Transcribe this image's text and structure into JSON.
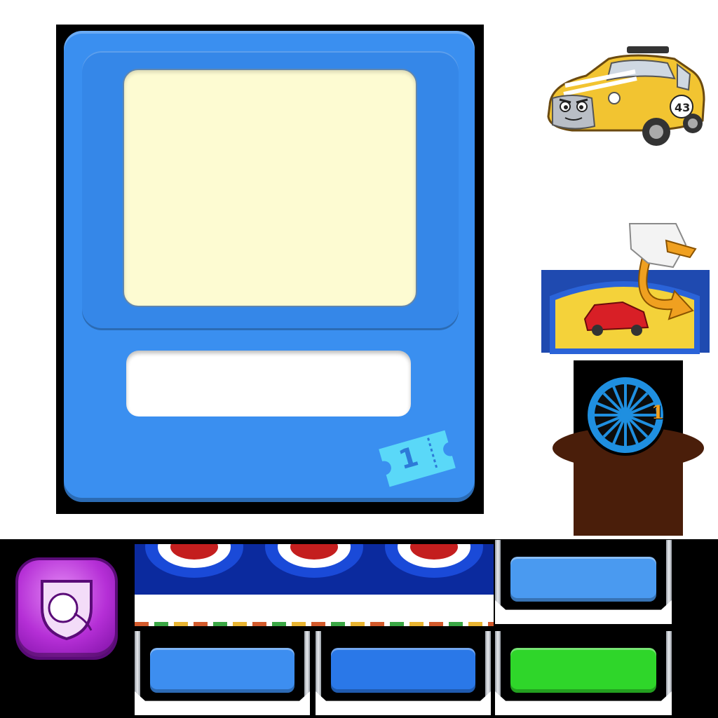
{
  "card": {
    "ticket_count": "1",
    "colors": {
      "card_blue": "#3a8ff0",
      "window": "#fdfbd2",
      "label": "#ffffff",
      "ticket": "#5ad8f8"
    }
  },
  "wheel_card": {
    "count": "1",
    "icon": "wheel-icon"
  },
  "car": {
    "number": "43",
    "color": "#f2c431"
  },
  "tutorial": {
    "icons": [
      "pointing-hand-icon",
      "curved-arrow-icon",
      "red-car-icon"
    ]
  },
  "ball_icon": {
    "icon": "ball-on-string-icon",
    "color": "#b52fd6"
  },
  "buttons": [
    {
      "color": "#4a9af0"
    },
    {
      "color": "#3d8ef0"
    },
    {
      "color": "#2a78e8"
    },
    {
      "color": "#2fd62a"
    }
  ]
}
